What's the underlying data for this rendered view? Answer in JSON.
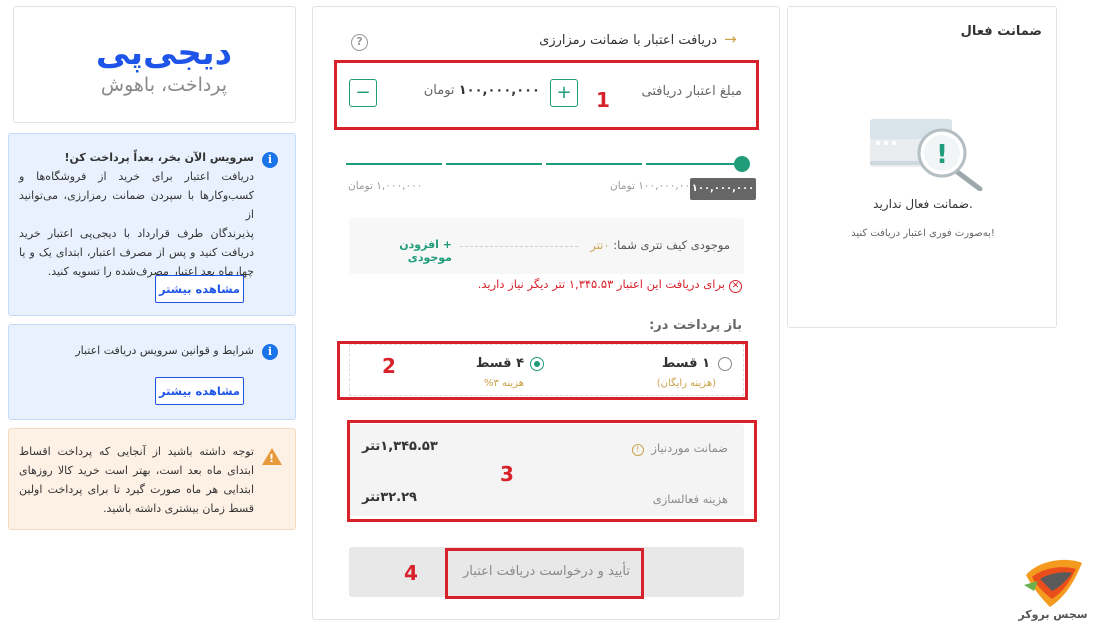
{
  "logo": {
    "brand": "دیجی‌پی",
    "tagline": "پرداخت، باهوش"
  },
  "info_cards": {
    "service": {
      "title": "سرویس الآن بخر، بعداً پرداخت کن!",
      "lines": [
        "دریافت اعتبار برای خرید از فروشگاه‌ها و",
        "کسب‌وکارها با سپرد‌ن ضمانت رمزارزی، می‌توانید از",
        "پذیرندگان طرف قرارداد با دیجی‌پی اعتبار خرید",
        "دریافت کنید و پس از مصرف اعتبار، ابتدای یک و یا",
        "چهارماه بعد اعتبار مصرف‌شده را تسویه کنید."
      ],
      "button": "مشاهده بیشتر"
    },
    "terms": {
      "title": "شرایط و قوانین سرویس دریافت اعتبار",
      "button": "مشاهده بیشتر"
    },
    "warning": {
      "lines": [
        "توجه داشته باشید از آنجایی که پرداخت اقساط",
        "ابتدای ماه بعد است، بهتر است خرید کالا روزهای",
        "ابتدایی هر ماه صورت گیرد تا برای پرداخت اولین",
        "قسط زمان بیشتری داشته باشید."
      ]
    }
  },
  "main": {
    "back_arrow": "←",
    "header_title": "دریافت اعتبار با ضمانت رمزارزی",
    "help_icon": "?",
    "amount": {
      "label": "مبلغ اعتبار دریافتی",
      "value": "۱۰۰,۰۰۰,۰۰۰",
      "unit": "تومان",
      "plus": "+",
      "minus": "−"
    },
    "slider": {
      "min_label": "۱,۰۰۰,۰۰۰ تومان",
      "max_label": "۱۰۰,۰۰۰,۰۰۰ تومان",
      "tooltip": "۱۰۰,۰۰۰,۰۰۰",
      "level": 1.0
    },
    "wallet": {
      "label": "موجودی کیف تتری شما:",
      "value": "۰تتر",
      "add_label": "افزودن موجودی",
      "add_icon": "+",
      "error": "برای دریافت این اعتبار ۱,۳۴۵.۵۳ تتر دیگر نیاز دارید."
    },
    "installments": {
      "title": "باز پرداخت در:",
      "options": [
        {
          "label": "۱ قسط",
          "sub": "(هزینه رایگان)",
          "selected": false
        },
        {
          "label": "۴ قسط",
          "sub": "هزینه ۳%",
          "selected": true
        }
      ]
    },
    "summary": {
      "required_label": "ضمانت موردنیاز",
      "required_value": "۱,۳۴۵.۵۳تتر",
      "fee_label": "هزینه فعالسازی",
      "fee_value": "۳۲.۲۹تتر"
    },
    "submit": "تأیید و درخواست دریافت اعتبار"
  },
  "annotations": [
    "1",
    "2",
    "3",
    "4"
  ],
  "active_guarantee": {
    "title": "ضمانت فعال",
    "empty_text": "ضمانت فعال ندارید.",
    "hint": "به‌صورت فوری اعتبار دریافت کنید!"
  },
  "watermark": {
    "text": "سجس بروکر"
  },
  "colors": {
    "brand": "#1e54e8",
    "accent": "#1f9c7a",
    "error": "#d7222b",
    "warning": "#e79a3c",
    "annotation": "#d7222b"
  }
}
